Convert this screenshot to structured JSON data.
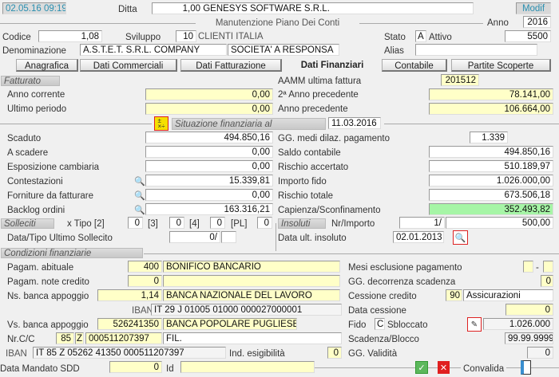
{
  "header": {
    "datetime": "02.05.16 09:19",
    "ditta_label": "Ditta",
    "ditta_code": "1,00",
    "ditta_name": "GENESYS SOFTWARE S.R.L.",
    "mode_button": "Modif",
    "title": "Manutenzione Piano Dei Conti",
    "anno_label": "Anno",
    "anno": "2016"
  },
  "account": {
    "codice_label": "Codice",
    "codice": "1,08",
    "sviluppo_label": "Sviluppo",
    "sviluppo": "10",
    "sviluppo_desc": "CLIENTI ITALIA",
    "stato_label": "Stato",
    "stato": "A",
    "stato_desc": "Attivo",
    "stato_value": "5500",
    "denominazione_label": "Denominazione",
    "denominazione1": "A.S.T.E.T. S.R.L. COMPANY",
    "denominazione2": "SOCIETA' A RESPONSA",
    "alias_label": "Alias",
    "alias": ""
  },
  "tabs": [
    {
      "label": "Anagrafica"
    },
    {
      "label": "Dati Commerciali"
    },
    {
      "label": "Dati Fatturazione"
    },
    {
      "label": "Dati Finanziari",
      "active": true
    },
    {
      "label": "Contabile"
    },
    {
      "label": "Partite Scoperte"
    }
  ],
  "fatturato": {
    "section": "Fatturato",
    "aamm_label": "AAMM ultima fattura",
    "aamm": "201512",
    "anno_corrente_label": "Anno corrente",
    "anno_corrente": "0,00",
    "ultimo_periodo_label": "Ultimo periodo",
    "ultimo_periodo": "0,00",
    "anno2_prec_label": "2ª Anno precedente",
    "anno2_prec": "78.141,00",
    "anno_prec_label": "Anno precedente",
    "anno_prec": "106.664,00"
  },
  "situazione": {
    "label": "Situazione finanziaria al",
    "date": "11.03.2016",
    "left": [
      {
        "label": "Scaduto",
        "value": "494.850,16"
      },
      {
        "label": "A scadere",
        "value": "0,00"
      },
      {
        "label": "Esposizione cambiaria",
        "value": "0,00"
      },
      {
        "label": "Contestazioni",
        "value": "15.339,81"
      },
      {
        "label": "Forniture da fatturare",
        "value": "0,00"
      },
      {
        "label": "Backlog ordini",
        "value": "163.316,21"
      }
    ],
    "gg_label": "GG. medi dilaz. pagamento",
    "gg": "1.339",
    "right": [
      {
        "label": "Saldo contabile",
        "value": "494.850,16"
      },
      {
        "label": "Rischio accertato",
        "value": "510.189,97"
      },
      {
        "label": "Importo fido",
        "value": "1.026.000,00"
      },
      {
        "label": "Rischio totale",
        "value": "673.506,18"
      },
      {
        "label": "Capienza/Sconfinamento",
        "value": "352.493,82"
      }
    ]
  },
  "solleciti": {
    "section": "Solleciti",
    "tipo2_label": "x Tipo [2]",
    "tipo2": "0",
    "tipo3_label": "[3]",
    "tipo3": "0",
    "tipo4_label": "[4]",
    "tipo4": "0",
    "pl_label": "[PL]",
    "pl": "0",
    "ultimo_label": "Data/Tipo Ultimo Sollecito",
    "ultimo_data": "0/",
    "ultimo_tipo": ""
  },
  "insoluti": {
    "section": "Insoluti",
    "nr_label": "Nr/Importo",
    "nr": "1/",
    "importo": "500,00",
    "data_label": "Data ult.  insoluto",
    "data": "02.01.2013"
  },
  "condizioni": {
    "section": "Condizioni finanziarie",
    "pag_abituale_label": "Pagam. abituale",
    "pag_abituale_code": "400",
    "pag_abituale_desc": "BONIFICO BANCARIO",
    "pag_note_label": "Pagam. note credito",
    "pag_note_code": "0",
    "pag_note_desc": "",
    "ns_banca_label": "Ns. banca appoggio",
    "ns_banca_code": "1,14",
    "ns_banca_desc": "BANCA NAZIONALE DEL LAVORO",
    "iban_label": "IBAN",
    "ns_iban": "IT 29 J 01005 01000 000027000001",
    "vs_banca_label": "Vs. banca appoggio",
    "vs_banca_code": "526241350",
    "vs_banca_desc": "BANCA POPOLARE PUGLIESE",
    "cc_label": "Nr.C/C",
    "cc_cin_num": "85",
    "cc_cin": "Z",
    "cc_num": "000511207397",
    "cc_fil": "FIL.",
    "vs_iban": "IT 85 Z 05262 41350 000511207397",
    "esig_label": "Ind. esigibilità",
    "esig": "0",
    "sdd_label": "Data Mandato SDD",
    "sdd": "0",
    "id_label": "Id",
    "id": "",
    "mesi_label": "Mesi esclusione pagamento",
    "mesi1": "",
    "mesi_sep": "-",
    "mesi2": "",
    "gg_decorrenza_label": "GG. decorrenza scadenza",
    "gg_decorrenza": "0",
    "cessione_label": "Cessione credito",
    "cessione_code": "90",
    "cessione_desc": "Assicurazioni",
    "data_cessione_label": "Data cessione",
    "data_cessione": "0",
    "fido_label": "Fido",
    "fido_code": "C",
    "fido_desc": "Sbloccato",
    "fido_value": "1.026.000",
    "scadenza_label": "Scadenza/Blocco",
    "scadenza": "99.99.9999",
    "validita_label": "GG. Validità",
    "validita": "0",
    "convalida_label": "Convalida"
  },
  "colors": {
    "yellow": "#ffffc8",
    "green": "#a6f5a6",
    "accent": "#2a8fb0"
  }
}
